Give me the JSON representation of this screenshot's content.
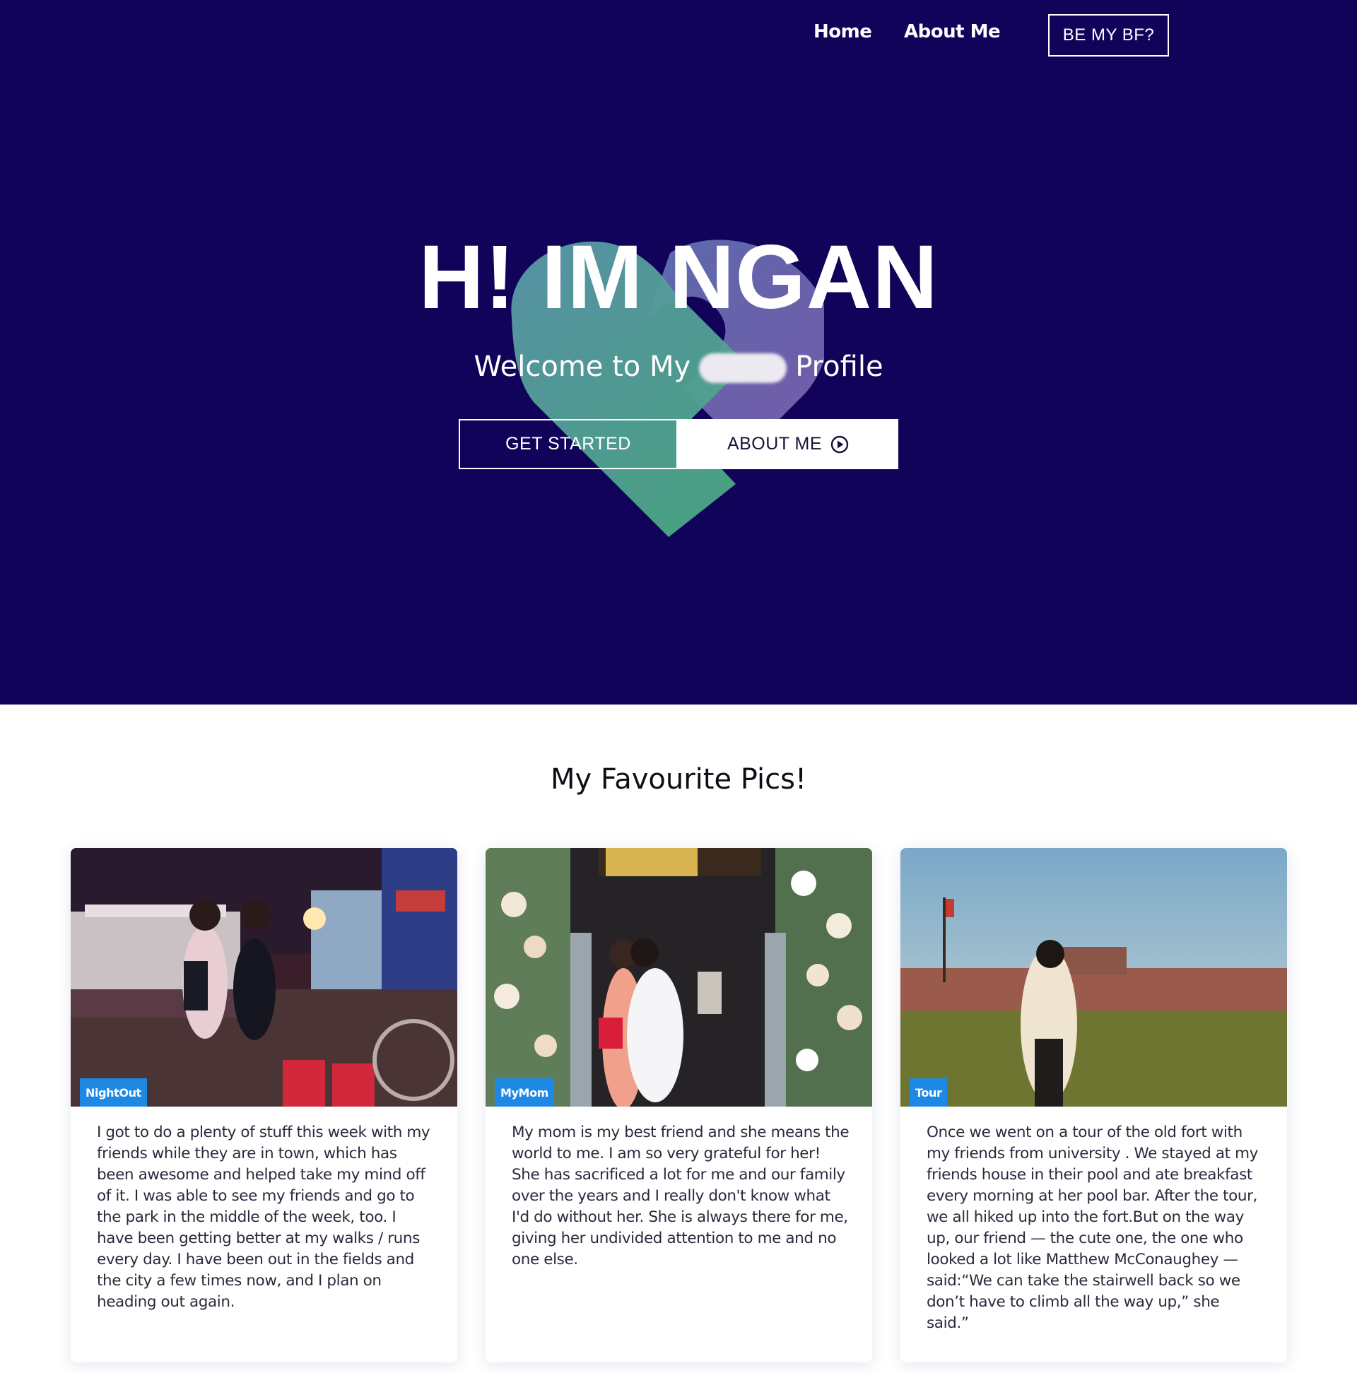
{
  "nav": {
    "home": "Home",
    "about": "About Me",
    "cta": "BE MY BF?"
  },
  "hero": {
    "title": "H! IM NGAN",
    "subtitle_before": "Welcome to My",
    "subtitle_after": "Profile",
    "get_started": "GET STARTED",
    "about_me": "ABOUT ME"
  },
  "section": {
    "title": "My Favourite Pics!"
  },
  "cards": [
    {
      "tag": "NightOut",
      "text": "I got to do a plenty of stuff this week with my friends while they are in town, which has been awesome and helped take my mind off of it. I was able to see my friends and go to the park in the middle of the week, too. I have been getting better at my walks / runs every day. I have been out in the fields and the city a few times now, and I plan on heading out again."
    },
    {
      "tag": "MyMom",
      "text": "My mom is my best friend and she means the world to me. I am so very grateful for her! She has sacrificed a lot for me and our family over the years and I really don't know what I'd do without her. She is always there for me, giving her undivided attention to me and no one else."
    },
    {
      "tag": "Tour",
      "text": "Once we went on a tour of the old fort with my friends from university . We stayed at my friends house in their pool and ate breakfast every morning at her pool bar. After the tour, we all hiked up into the fort.But on the way up, our friend — the cute one, the one who looked a lot like Matthew McConaughey — said:“We can take the stairwell back so we don’t have to climb all the way up,” she said.”"
    }
  ],
  "colors": {
    "hero_bg": "#12035a",
    "tag_bg": "#1e88e5",
    "heart_green": "#4ea88a",
    "heart_purple": "#6b5aa6"
  },
  "icons": {
    "play": "play-circle-icon"
  }
}
